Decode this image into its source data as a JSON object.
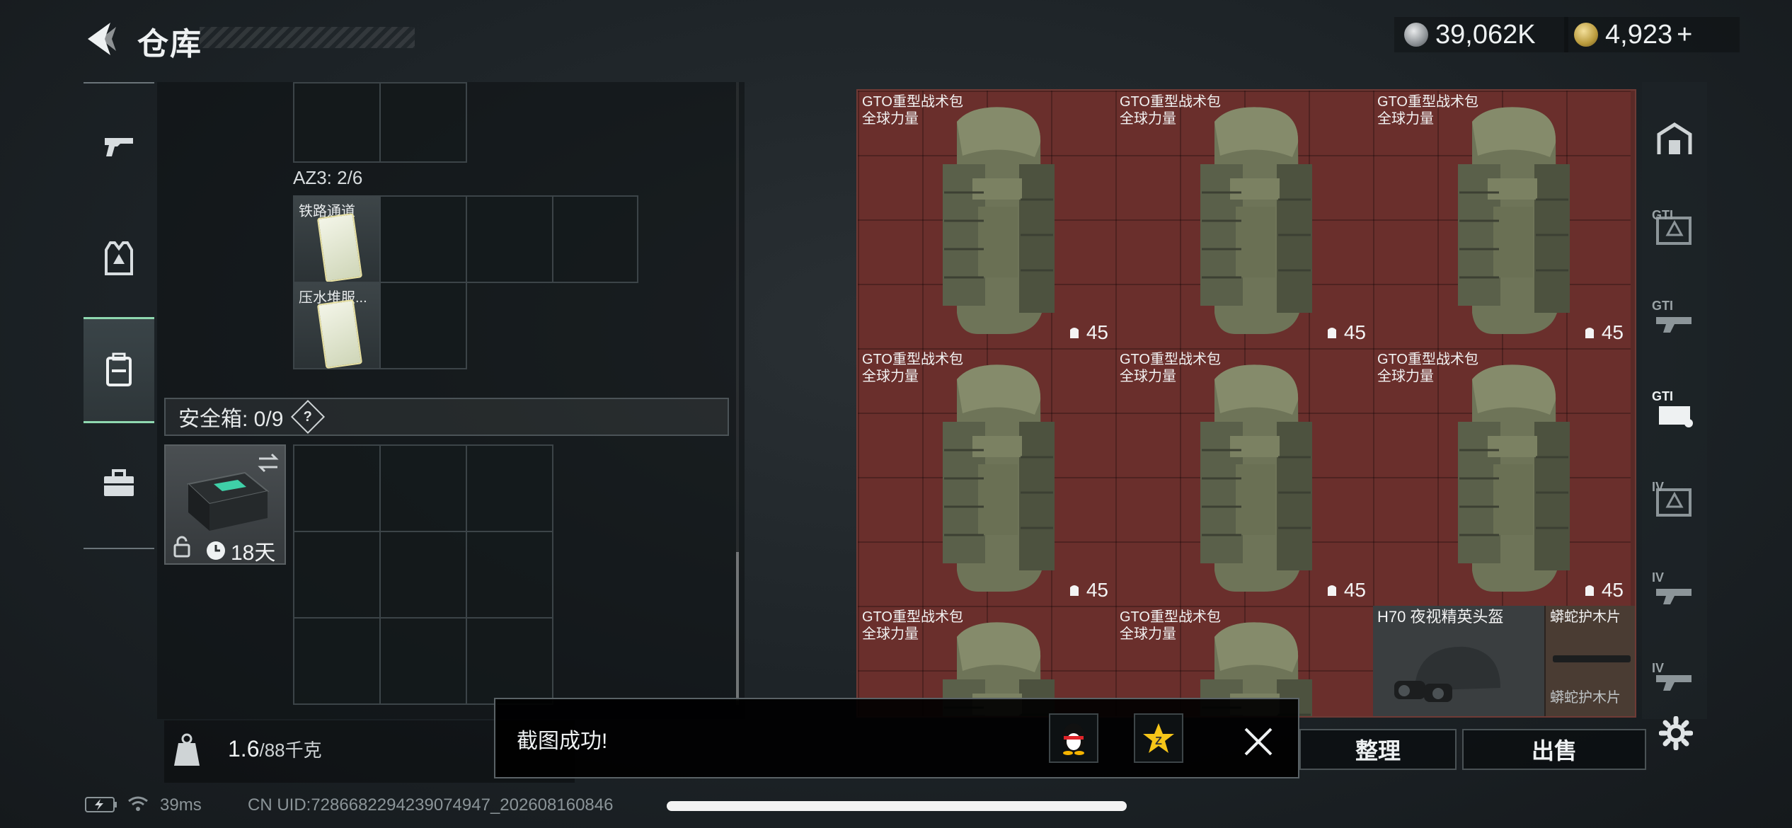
{
  "header": {
    "title": "仓库",
    "currency_silver": "39,062K",
    "currency_gold": "4,923",
    "add_label": "+"
  },
  "left_rail": {
    "items": [
      {
        "icon": "pistol-icon"
      },
      {
        "icon": "vest-icon"
      },
      {
        "icon": "backpack-icon",
        "active": true
      },
      {
        "icon": "toolbox-icon"
      }
    ]
  },
  "container": {
    "az3_label": "AZ3: 2/6",
    "items": [
      {
        "name": "铁路通道"
      },
      {
        "name": "压水堆服..."
      }
    ]
  },
  "safe_box": {
    "label": "安全箱: 0/9",
    "help": "?",
    "days": "18天"
  },
  "weight": {
    "current": "1.6",
    "max_unit": "/88千克"
  },
  "stash": {
    "tiles": [
      {
        "name": "GTO重型战术包",
        "sub": "全球力量",
        "qty": "45"
      },
      {
        "name": "GTO重型战术包",
        "sub": "全球力量",
        "qty": "45"
      },
      {
        "name": "GTO重型战术包",
        "sub": "全球力量",
        "qty": "45"
      },
      {
        "name": "GTO重型战术包",
        "sub": "全球力量",
        "qty": "45"
      },
      {
        "name": "GTO重型战术包",
        "sub": "全球力量",
        "qty": "45"
      },
      {
        "name": "GTO重型战术包",
        "sub": "全球力量",
        "qty": "45"
      },
      {
        "name": "GTO重型战术包",
        "sub": "全球力量"
      },
      {
        "name": "GTO重型战术包",
        "sub": "全球力量"
      }
    ],
    "helmet_name": "H70 夜视精英头盔",
    "plank_name": "蟒蛇护木片",
    "plank_name_2": "蟒蛇护木片",
    "sort_button": "整理",
    "sell_button": "出售"
  },
  "right_rail": {
    "tabs": [
      "GTI",
      "GTI",
      "GTI",
      "IV",
      "IV",
      "IV"
    ]
  },
  "toast": {
    "message": "截图成功!"
  },
  "status": {
    "ping": "39ms",
    "uid": "CN UID:7286682294239074947_202608160846"
  }
}
